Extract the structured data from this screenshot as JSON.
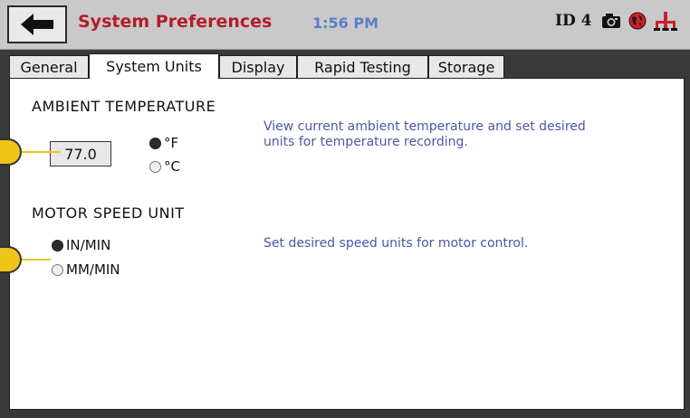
{
  "header": {
    "title": "System Preferences",
    "time": "1:56 PM",
    "id_label": "ID 4",
    "icons": [
      "camera-icon",
      "globe-icon",
      "network-icon"
    ]
  },
  "tabs": [
    {
      "label": "General",
      "active": false
    },
    {
      "label": "System Units",
      "active": true
    },
    {
      "label": "Display",
      "active": false
    },
    {
      "label": "Rapid Testing",
      "active": false
    },
    {
      "label": "Storage",
      "active": false
    }
  ],
  "ambient": {
    "heading": "AMBIENT TEMPERATURE",
    "value": "77.0",
    "description_line1": "View current ambient temperature and set desired",
    "description_line2": "units for temperature recording.",
    "options": [
      {
        "label": "°F",
        "selected": true
      },
      {
        "label": "°C",
        "selected": false
      }
    ]
  },
  "motor": {
    "heading": "MOTOR SPEED UNIT",
    "description": "Set desired speed units for motor control.",
    "options": [
      {
        "label": "IN/MIN",
        "selected": true
      },
      {
        "label": "MM/MIN",
        "selected": false
      }
    ]
  },
  "colors": {
    "title": "#b41d2c",
    "clock": "#5a7fc9",
    "description": "#4a57a8",
    "callout": "#f0c419"
  }
}
